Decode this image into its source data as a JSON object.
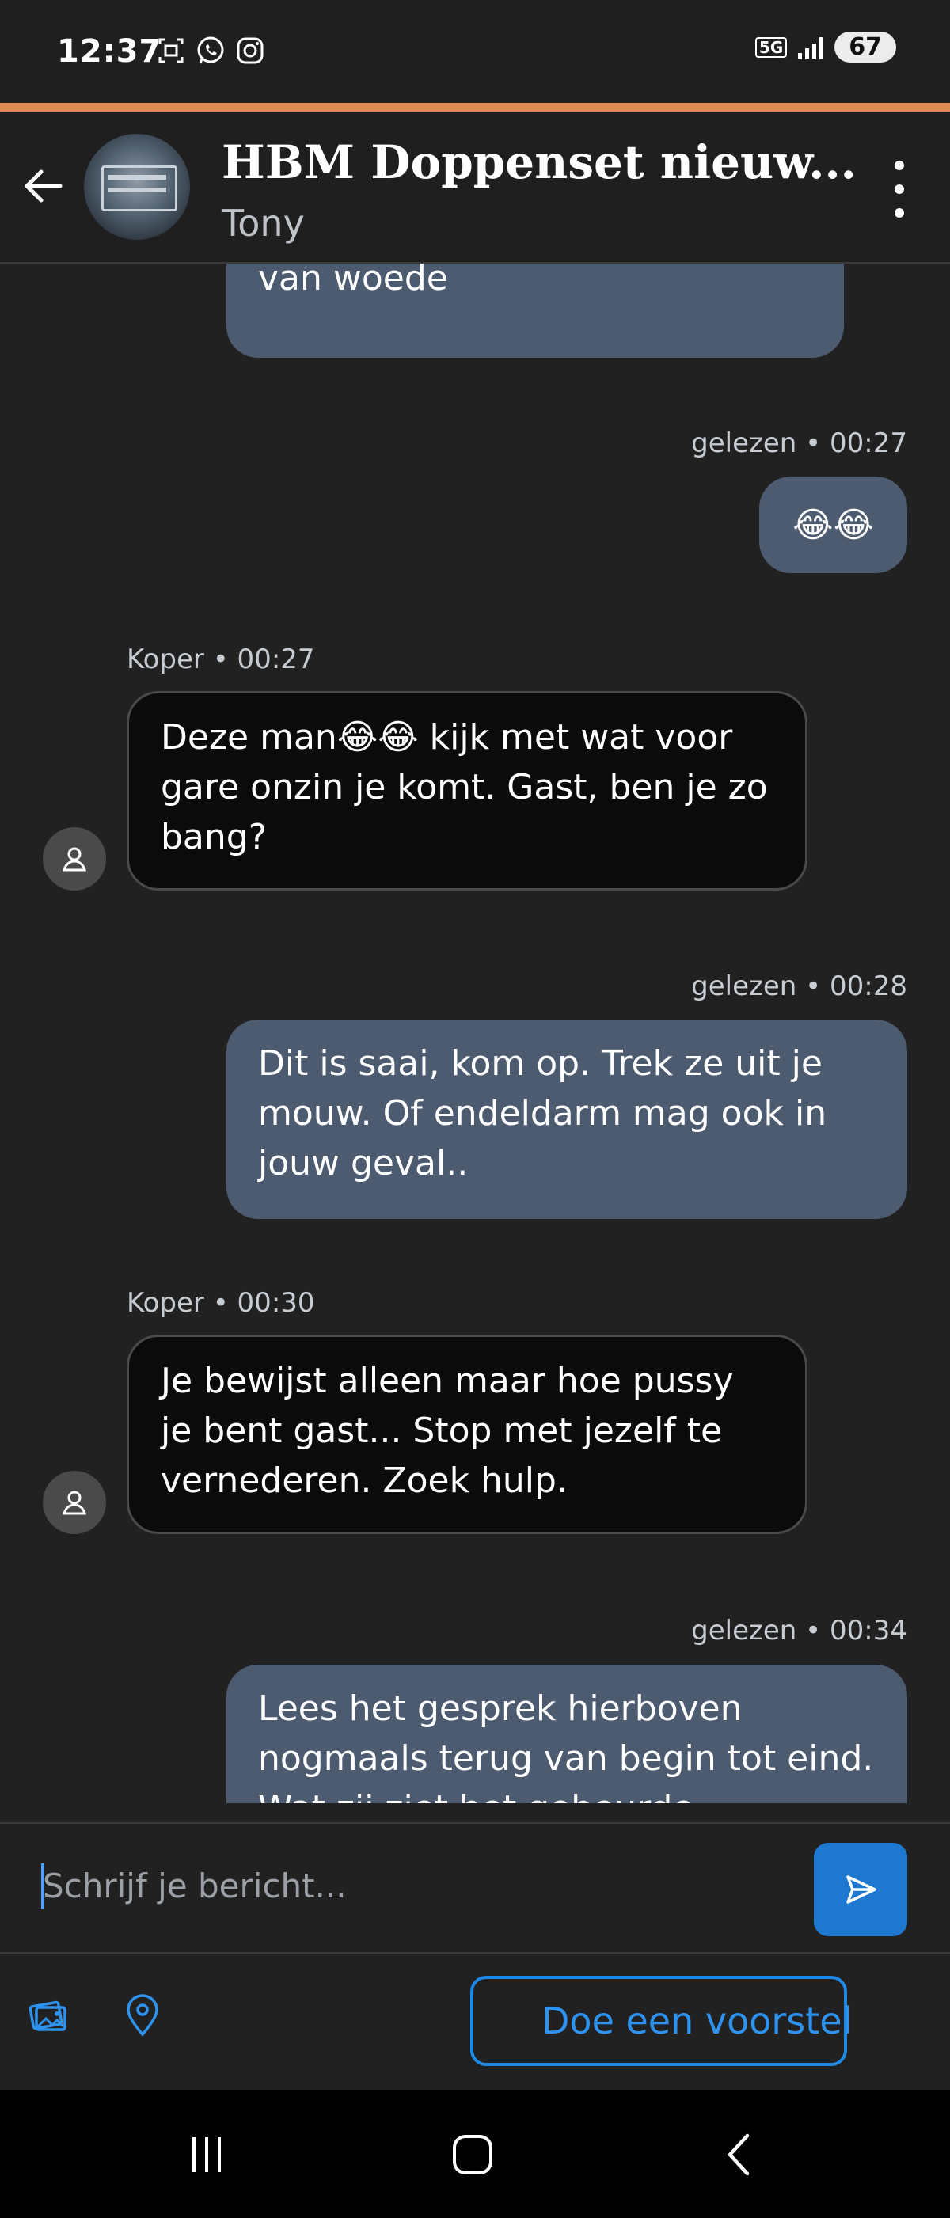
{
  "status_bar": {
    "time": "12:37",
    "network": "5G",
    "battery": "67"
  },
  "header": {
    "title": "HBM Doppenset nieuw...",
    "subtitle": "Tony"
  },
  "messages": [
    {
      "direction": "out",
      "text": "is geworden. Je zal wel koken van woede"
    },
    {
      "direction": "out",
      "meta": "gelezen • 00:27",
      "text": "😂😂"
    },
    {
      "direction": "in",
      "meta": "Koper • 00:27",
      "text": "Deze man😂😂 kijk met wat voor gare onzin je komt. Gast, ben je zo bang?"
    },
    {
      "direction": "out",
      "meta": "gelezen • 00:28",
      "text": "Dit is saai, kom op. Trek ze uit je mouw. Of endeldarm mag ook in jouw geval.."
    },
    {
      "direction": "in",
      "meta": "Koper • 00:30",
      "text": "Je bewijst alleen maar hoe pussy je bent gast... Stop met jezelf te vernederen. Zoek hulp."
    },
    {
      "direction": "out",
      "meta": "gelezen • 00:34",
      "text": "Lees het gesprek hierboven nogmaals terug van begin tot eind. Wat zij ziet het gebeurde..."
    }
  ],
  "composer": {
    "placeholder": "Schrijf je bericht..."
  },
  "actions": {
    "offer_label": "Doe een voorstel"
  },
  "colors": {
    "accent": "#e08a52",
    "outgoing_bubble": "#4d5b71",
    "incoming_bubble": "#0b0b0b",
    "primary": "#1e78d0"
  }
}
